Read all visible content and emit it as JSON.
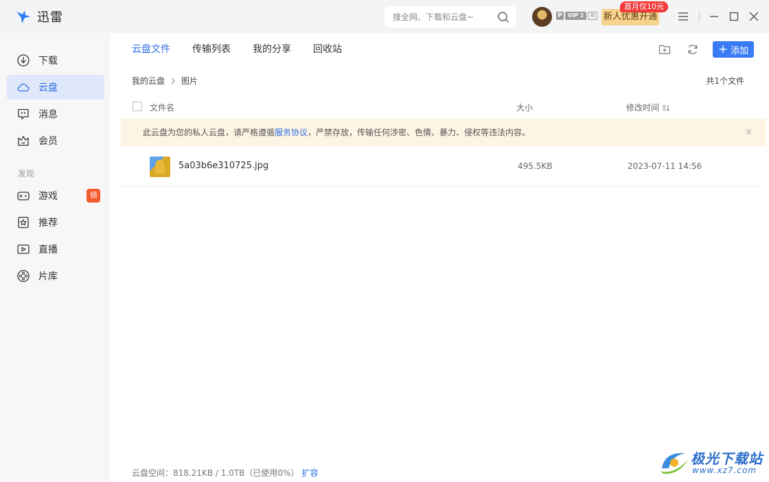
{
  "app": {
    "title": "迅雷"
  },
  "search": {
    "placeholder": "搜全网、下载和云盘~"
  },
  "user": {
    "vip_p": "P",
    "vip_level": "VIP 1",
    "vip_year": "年",
    "promo_label": "新人优惠开通",
    "promo_tag": "首月仅10元"
  },
  "sidebar": {
    "items": [
      {
        "label": "下载",
        "icon": "download-icon"
      },
      {
        "label": "云盘",
        "icon": "cloud-icon",
        "active": true
      },
      {
        "label": "消息",
        "icon": "message-icon"
      },
      {
        "label": "会员",
        "icon": "crown-icon"
      }
    ],
    "section_label": "发现",
    "discover_items": [
      {
        "label": "游戏",
        "icon": "gamepad-icon",
        "badge": "领"
      },
      {
        "label": "推荐",
        "icon": "star-icon"
      },
      {
        "label": "直播",
        "icon": "live-icon"
      },
      {
        "label": "片库",
        "icon": "film-reel-icon"
      }
    ]
  },
  "tabs": [
    {
      "label": "云盘文件",
      "active": true
    },
    {
      "label": "传输列表"
    },
    {
      "label": "我的分享"
    },
    {
      "label": "回收站"
    }
  ],
  "toolbar": {
    "add_label": "添加"
  },
  "breadcrumb": {
    "root": "我的云盘",
    "current": "图片"
  },
  "file_count": "共1个文件",
  "columns": {
    "name": "文件名",
    "size": "大小",
    "modified": "修改时间"
  },
  "notice": {
    "before": "此云盘为您的私人云盘，请严格遵循",
    "link": "服务协议",
    "after": "，严禁存放，传输任何涉密、色情、暴力、侵权等违法内容。",
    "close": "×"
  },
  "files": [
    {
      "name": "5a03b6e310725.jpg",
      "size": "495.5KB",
      "modified": "2023-07-11 14:56"
    }
  ],
  "footer": {
    "storage": "云盘空间：818.21KB / 1.0TB（已使用0%）",
    "expand_link": "扩容"
  },
  "watermark": {
    "title": "极光下载站",
    "url": "www.xz7.com"
  },
  "colors": {
    "accent": "#2f6fe4",
    "active_bg": "#dfe8fa",
    "notice_bg": "#fef4e4",
    "promo": "#f6d48d",
    "badge_red": "#f25a2c"
  }
}
